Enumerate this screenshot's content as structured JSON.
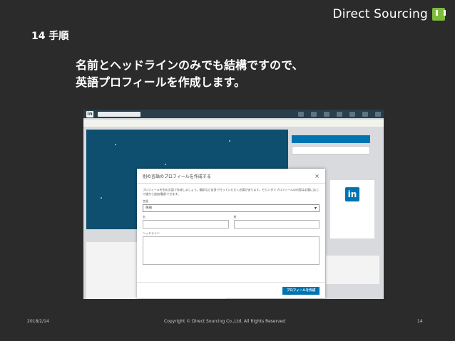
{
  "brand": {
    "name": "Direct Sourcing"
  },
  "slide": {
    "title": "14 手順",
    "headline": [
      "名前とヘッドラインのみでも結構ですので、",
      "英語プロフィールを作成します。"
    ]
  },
  "modal": {
    "title": "別の言語のプロフィールを作成する",
    "close": "×",
    "description": "プロフィールを別の言語で作成しましょう。翻訳など自身で行っていただく必要があります。セカンダリプロフィールの内容は必要に応じて後から追加/翻訳できます。",
    "language_label": "言語",
    "language_value": "英語",
    "first_name_label": "名",
    "last_name_label": "姓",
    "headline_label": "ヘッドライン",
    "submit_label": "プロフィールを作成"
  },
  "colors": {
    "brand_icon": "#7dbb3a",
    "linkedin_blue": "#0073b1",
    "linkedin_nav": "#283e4a",
    "slide_bg": "#2b2b2b"
  },
  "footer": {
    "date": "2018/2/14",
    "copyright": "Copyright © Direct Sourcing Co.,Ltd. All Rights Reserved",
    "page": "14"
  }
}
